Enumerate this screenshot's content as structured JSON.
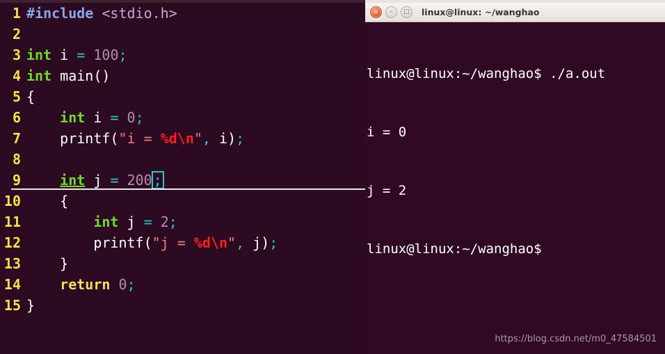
{
  "editor": {
    "name": "vim-c-editor",
    "background_color": "#2c0a22",
    "lineno_color": "#f5e24f",
    "cursor_line": 9,
    "cursor_char": ";",
    "lines": [
      {
        "number": "1",
        "text": "#include <stdio.h>"
      },
      {
        "number": "2",
        "text": ""
      },
      {
        "number": "3",
        "text": "int i = 100;"
      },
      {
        "number": "4",
        "text": "int main()"
      },
      {
        "number": "5",
        "text": "{"
      },
      {
        "number": "6",
        "text": "    int i = 0;"
      },
      {
        "number": "7",
        "text": "    printf(\"i = %d\\n\", i);"
      },
      {
        "number": "8",
        "text": ""
      },
      {
        "number": "9",
        "text": "    int j = 200;"
      },
      {
        "number": "10",
        "text": "    {"
      },
      {
        "number": "11",
        "text": "        int j = 2;"
      },
      {
        "number": "12",
        "text": "        printf(\"j = %d\\n\", j);"
      },
      {
        "number": "13",
        "text": "    }"
      },
      {
        "number": "14",
        "text": "    return 0;"
      },
      {
        "number": "15",
        "text": "}"
      }
    ],
    "tokens": {
      "preprocessor": "#include",
      "header": "<stdio.h>",
      "type_keyword": "int",
      "return_keyword": "return",
      "function_printf": "printf",
      "var_i": "i",
      "var_j": "j",
      "main": "main",
      "num_100": "100",
      "num_0": "0",
      "num_200": "200",
      "num_2": "2",
      "str_i": "i = ",
      "str_j": "j = ",
      "fmt_d": "%d",
      "esc_n": "\\n",
      "semicolon": ";",
      "assign": "="
    },
    "syntax_colors": {
      "preprocessor": "#8aa6e8",
      "header": "#c9a6c9",
      "type": "#6fd82f",
      "keyword": "#f2e05a",
      "identifier": "#ffffff",
      "operator": "#2ec8c8",
      "number": "#b48ead",
      "string": "#ef8080",
      "escape": "#fa1f1f",
      "cursor": "#2ec8c8"
    }
  },
  "terminal": {
    "name": "gnome-terminal",
    "title": "linux@linux: ~/wanghao",
    "background_color": "#300a24",
    "titlebar_color": "#f0ece8",
    "buttons": {
      "close": "×",
      "minimize": "–",
      "maximize": "□"
    },
    "lines": [
      {
        "prompt": "linux@linux:~/wanghao$",
        "command": " ./a.out"
      },
      {
        "prompt": "",
        "command": "i = 0"
      },
      {
        "prompt": "",
        "command": "j = 2"
      },
      {
        "prompt": "linux@linux:~/wanghao$",
        "command": ""
      }
    ]
  },
  "watermark": {
    "text": "https://blog.csdn.net/m0_47584501"
  }
}
